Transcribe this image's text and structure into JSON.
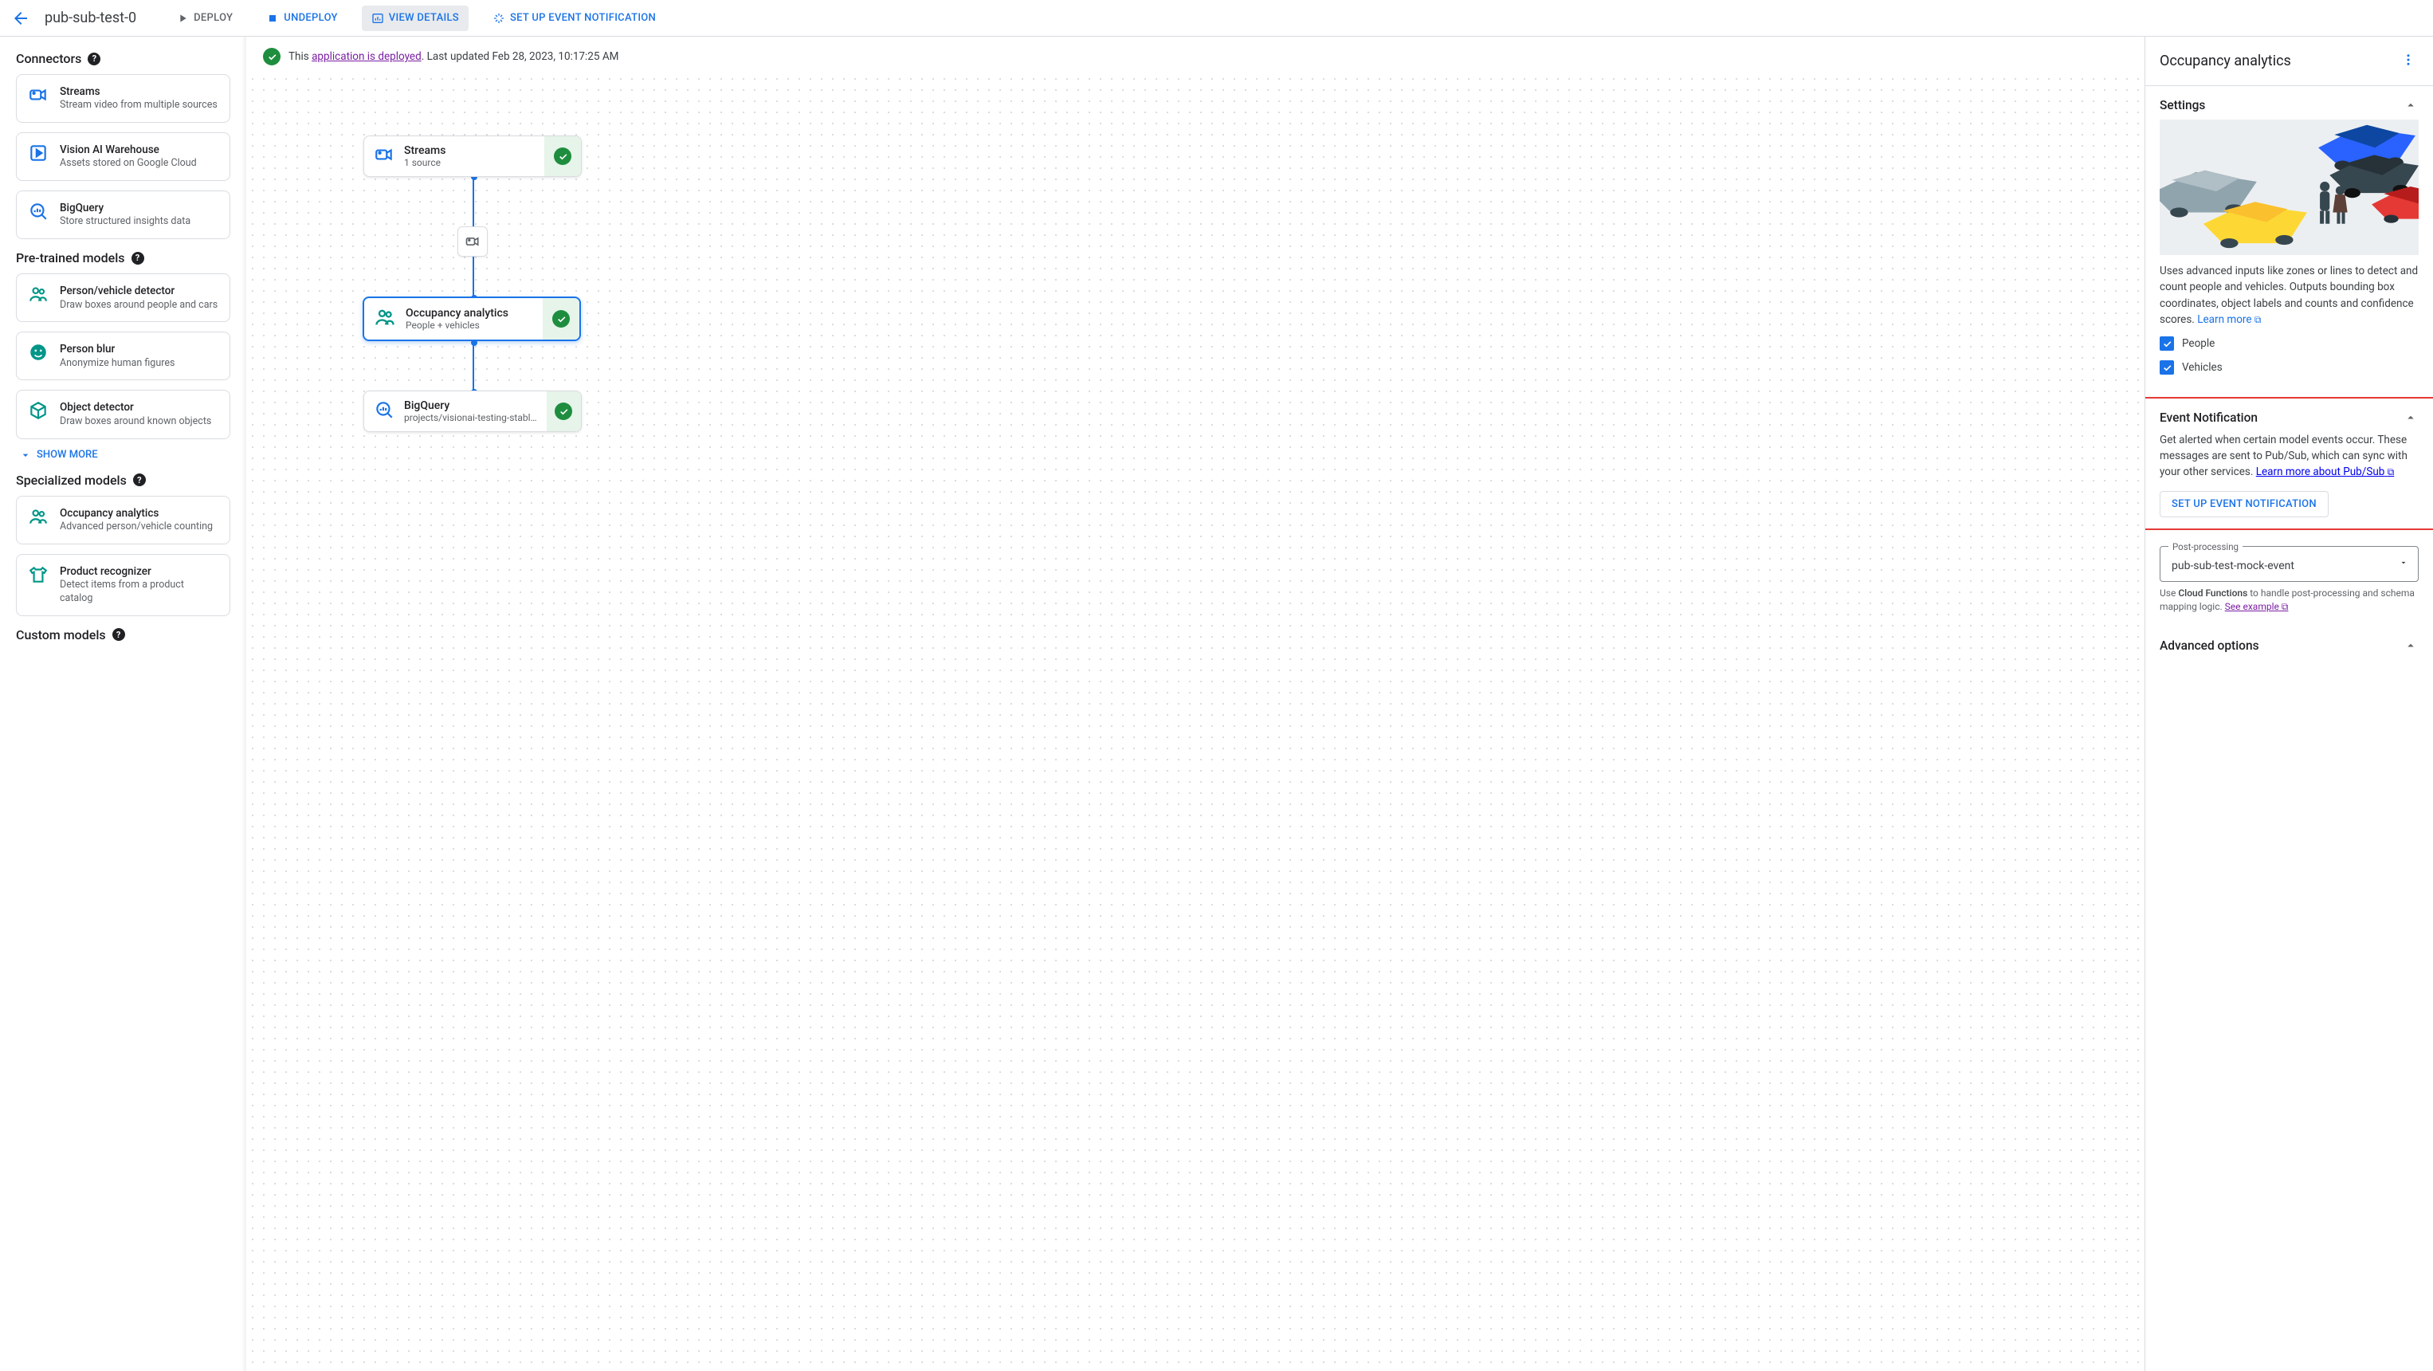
{
  "appbar": {
    "title": "pub-sub-test-0",
    "actions": {
      "deploy": "DEPLOY",
      "undeploy": "UNDEPLOY",
      "view_details": "VIEW DETAILS",
      "set_up_event_notification": "SET UP EVENT NOTIFICATION"
    }
  },
  "status": {
    "prefix": "This ",
    "link_text": "application is deployed",
    "suffix": ". Last updated Feb 28, 2023, 10:17:25 AM"
  },
  "left": {
    "sections": {
      "connectors": "Connectors",
      "pretrained": "Pre-trained models",
      "specialized": "Specialized models",
      "custom": "Custom models"
    },
    "connectors": [
      {
        "title": "Streams",
        "sub": "Stream video from multiple sources"
      },
      {
        "title": "Vision AI Warehouse",
        "sub": "Assets stored on Google Cloud"
      },
      {
        "title": "BigQuery",
        "sub": "Store structured insights data"
      }
    ],
    "pretrained": [
      {
        "title": "Person/vehicle detector",
        "sub": "Draw boxes around people and cars"
      },
      {
        "title": "Person blur",
        "sub": "Anonymize human figures"
      },
      {
        "title": "Object detector",
        "sub": "Draw boxes around known objects"
      }
    ],
    "show_more": "SHOW MORE",
    "specialized": [
      {
        "title": "Occupancy analytics",
        "sub": "Advanced person/vehicle counting"
      },
      {
        "title": "Product recognizer",
        "sub": "Detect items from a product catalog"
      }
    ]
  },
  "flow": {
    "streams": {
      "title": "Streams",
      "sub": "1 source"
    },
    "occupancy": {
      "title": "Occupancy analytics",
      "sub": "People + vehicles"
    },
    "bigquery": {
      "title": "BigQuery",
      "sub": "projects/visionai-testing-stabl…"
    }
  },
  "right": {
    "title": "Occupancy analytics",
    "settings": {
      "heading": "Settings",
      "desc_pre": "Uses advanced inputs like zones or lines to detect and count people and vehicles. Outputs bounding box coordinates, object labels and counts and confidence scores. ",
      "learn_more": "Learn more",
      "people_label": "People",
      "vehicles_label": "Vehicles"
    },
    "event": {
      "heading": "Event Notification",
      "desc_pre": "Get alerted when certain model events occur. These messages are sent to Pub/Sub, which can sync with your other services. ",
      "learn_more": "Learn more about Pub/Sub",
      "button": "SET UP EVENT NOTIFICATION"
    },
    "post": {
      "label": "Post-processing",
      "value": "pub-sub-test-mock-event",
      "hint_pre": "Use ",
      "hint_bold": "Cloud Functions",
      "hint_mid": " to handle post-processing and schema mapping logic. ",
      "hint_link": "See example"
    },
    "advanced_heading": "Advanced options"
  }
}
